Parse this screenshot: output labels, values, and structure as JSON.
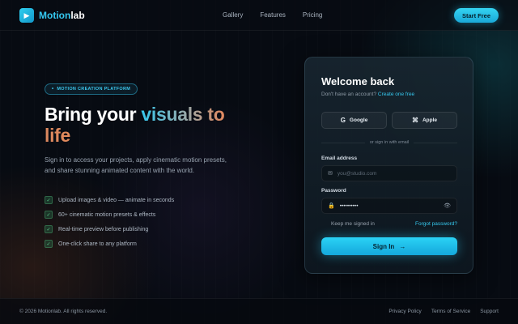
{
  "header": {
    "logo_icon": "play-icon",
    "logo_prefix": "Motion",
    "logo_suffix": "lab",
    "nav": [
      "Gallery",
      "Features",
      "Pricing"
    ],
    "cta": "Start Free"
  },
  "hero": {
    "badge": "MOTION CREATION PLATFORM",
    "title_part1": "Bring your ",
    "title_highlight": "visuals to",
    "title_part2": "life",
    "subtitle": "Sign in to access your projects, apply cinematic motion presets, and share stunning animated content with the world.",
    "features": [
      "Upload images & video — animate in seconds",
      "60+ cinematic motion presets & effects",
      "Real-time preview before publishing",
      "One-click share to any platform"
    ]
  },
  "login": {
    "title": "Welcome back",
    "no_account": "Don't have an account?",
    "create_link": "Create one free",
    "google_label": "Google",
    "apple_label": "Apple",
    "divider": "or sign in with email",
    "email_label": "Email address",
    "email_placeholder": "you@studio.com",
    "password_label": "Password",
    "password_value": "••••••••••",
    "remember_label": "Keep me signed in",
    "forgot_link": "Forgot password?",
    "submit_label": "Sign In",
    "submit_arrow": "→"
  },
  "footer": {
    "copyright": "© 2026 Motionlab. All rights reserved.",
    "links": [
      "Privacy Policy",
      "Terms of Service",
      "Support"
    ]
  },
  "colors": {
    "accent": "#35c8f0",
    "background": "#070b12",
    "gradient_warm": "#e3895e"
  }
}
